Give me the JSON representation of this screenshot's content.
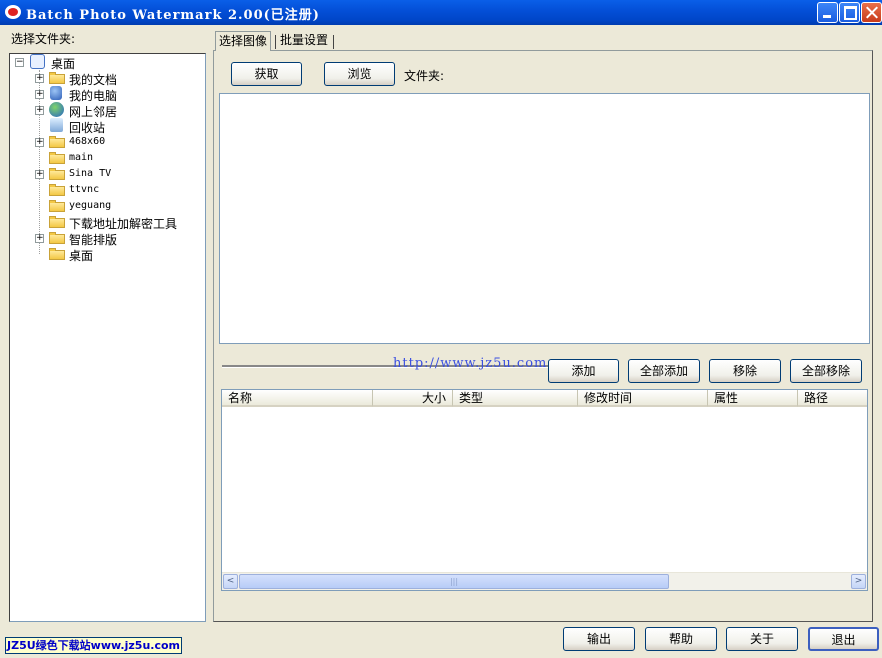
{
  "window": {
    "title": "Batch Photo Watermark 2.00(已注册)"
  },
  "left": {
    "label": "选择文件夹:",
    "tree": [
      {
        "label": "桌面",
        "expander": "−",
        "icon": "desktop-icon"
      },
      {
        "label": "我的文档",
        "expander": "+",
        "icon": "my-documents-icon"
      },
      {
        "label": "我的电脑",
        "expander": "+",
        "icon": "my-computer-icon"
      },
      {
        "label": "网上邻居",
        "expander": "+",
        "icon": "network-icon"
      },
      {
        "label": "回收站",
        "expander": "",
        "icon": "recycle-bin-icon"
      },
      {
        "label": "468x60",
        "expander": "+",
        "icon": "folder-icon"
      },
      {
        "label": "main",
        "expander": "",
        "icon": "folder-icon"
      },
      {
        "label": "Sina TV",
        "expander": "+",
        "icon": "folder-icon"
      },
      {
        "label": "ttvnc",
        "expander": "",
        "icon": "folder-icon"
      },
      {
        "label": "yeguang",
        "expander": "",
        "icon": "folder-icon"
      },
      {
        "label": "下载地址加解密工具",
        "expander": "",
        "icon": "folder-icon"
      },
      {
        "label": "智能排版",
        "expander": "+",
        "icon": "folder-icon"
      },
      {
        "label": "桌面",
        "expander": "",
        "icon": "folder-icon"
      }
    ]
  },
  "tabs": [
    {
      "label": "选择图像"
    },
    {
      "label": "批量设置"
    }
  ],
  "toolbar": {
    "get": "获取",
    "browse": "浏览",
    "folder_label": "文件夹:"
  },
  "watermark_url": "http://www.jz5u.com",
  "list_buttons": {
    "add": "添加",
    "add_all": "全部添加",
    "remove": "移除",
    "remove_all": "全部移除"
  },
  "columns": [
    "名称",
    "大小",
    "类型",
    "修改时间",
    "属性",
    "路径"
  ],
  "scrollbar": {
    "left": "<",
    "right": ">",
    "grip": "|||"
  },
  "footer": {
    "output": "输出",
    "help": "帮助",
    "about": "关于",
    "exit": "退出"
  },
  "status_link": "JZ5U绿色下载站www.jz5u.com",
  "colors": {
    "title_bar": "#0450D8",
    "face": "#ECE9D8",
    "link": "#0000C8",
    "watermark": "#3A4FE0"
  }
}
